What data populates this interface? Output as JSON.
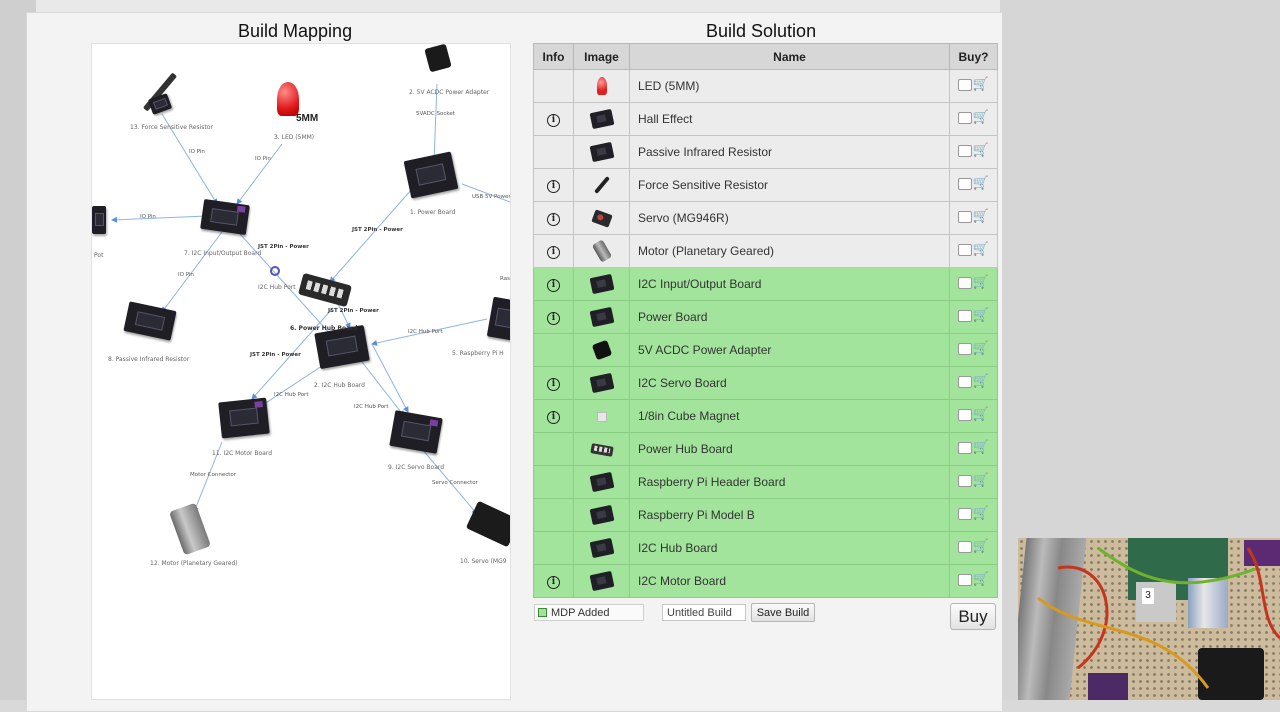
{
  "mapping": {
    "title": "Build Mapping",
    "nodes": [
      {
        "label": "13. Force Sensitive Resistor"
      },
      {
        "label": "3. LED (5MM)"
      },
      {
        "label": "5MM"
      },
      {
        "label": "2. 5V ACDC Power Adapter"
      },
      {
        "label": "1. Power Board"
      },
      {
        "label": "7. I2C Input/Output Board"
      },
      {
        "label": "8. Passive Infrared Resistor"
      },
      {
        "label": "6. Power Hub Board"
      },
      {
        "label": "2. I2C Hub Board"
      },
      {
        "label": "5. Raspberry Pi H"
      },
      {
        "label": "11. I2C Motor Board"
      },
      {
        "label": "9. I2C Servo Board"
      },
      {
        "label": "12. Motor (Planetary Geared)"
      },
      {
        "label": "10. Servo (MG9"
      },
      {
        "label": "Pot"
      },
      {
        "label": "I2C Hub Port"
      }
    ],
    "edges": [
      {
        "label": "IO Pin"
      },
      {
        "label": "IO Pin"
      },
      {
        "label": "5VADC Socket"
      },
      {
        "label": "USB 5V Power"
      },
      {
        "label": "IO Pin"
      },
      {
        "label": "JST 2Pin - Power"
      },
      {
        "label": "JST 2Pin - Power"
      },
      {
        "label": "IO Pin"
      },
      {
        "label": "JST 2Pin - Power"
      },
      {
        "label": "I2C Hub Port"
      },
      {
        "label": "JST 2Pin - Power"
      },
      {
        "label": "I2C Hub Port"
      },
      {
        "label": "I2C Hub Port"
      },
      {
        "label": "Motor Connector"
      },
      {
        "label": "Servo Connector"
      },
      {
        "label": "Ras"
      }
    ]
  },
  "solution": {
    "title": "Build Solution",
    "columns": {
      "info": "Info",
      "image": "Image",
      "name": "Name",
      "buy": "Buy?"
    },
    "rows": [
      {
        "name": "LED (5MM)",
        "info": false,
        "added": false,
        "icon": "led-icon"
      },
      {
        "name": "Hall Effect",
        "info": true,
        "added": false,
        "icon": "sensor-board-icon"
      },
      {
        "name": "Passive Infrared Resistor",
        "info": false,
        "added": false,
        "icon": "pir-sensor-icon"
      },
      {
        "name": "Force Sensitive Resistor",
        "info": true,
        "added": false,
        "icon": "force-resistor-icon"
      },
      {
        "name": "Servo (MG946R)",
        "info": true,
        "added": false,
        "icon": "servo-icon"
      },
      {
        "name": "Motor (Planetary Geared)",
        "info": true,
        "added": false,
        "icon": "motor-icon"
      },
      {
        "name": "I2C Input/Output Board",
        "info": true,
        "added": true,
        "icon": "io-board-icon"
      },
      {
        "name": "Power Board",
        "info": true,
        "added": true,
        "icon": "power-board-icon"
      },
      {
        "name": "5V ACDC Power Adapter",
        "info": false,
        "added": true,
        "icon": "power-adapter-icon"
      },
      {
        "name": "I2C Servo Board",
        "info": true,
        "added": true,
        "icon": "servo-board-icon"
      },
      {
        "name": "1/8in Cube Magnet",
        "info": true,
        "added": true,
        "icon": "magnet-icon"
      },
      {
        "name": "Power Hub Board",
        "info": false,
        "added": true,
        "icon": "hub-board-icon"
      },
      {
        "name": "Raspberry Pi Header Board",
        "info": false,
        "added": true,
        "icon": "header-board-icon"
      },
      {
        "name": "Raspberry Pi Model B",
        "info": false,
        "added": true,
        "icon": "raspberry-pi-icon"
      },
      {
        "name": "I2C Hub Board",
        "info": false,
        "added": true,
        "icon": "i2c-hub-icon"
      },
      {
        "name": "I2C Motor Board",
        "info": true,
        "added": true,
        "icon": "motor-board-icon"
      }
    ],
    "legend": "MDP Added",
    "build_name": "Untitled Build",
    "save_label": "Save Build",
    "buy_label": "Buy",
    "info_glyph": "i",
    "cart_glyph": "🛒"
  },
  "webcam": {
    "label": "3"
  }
}
